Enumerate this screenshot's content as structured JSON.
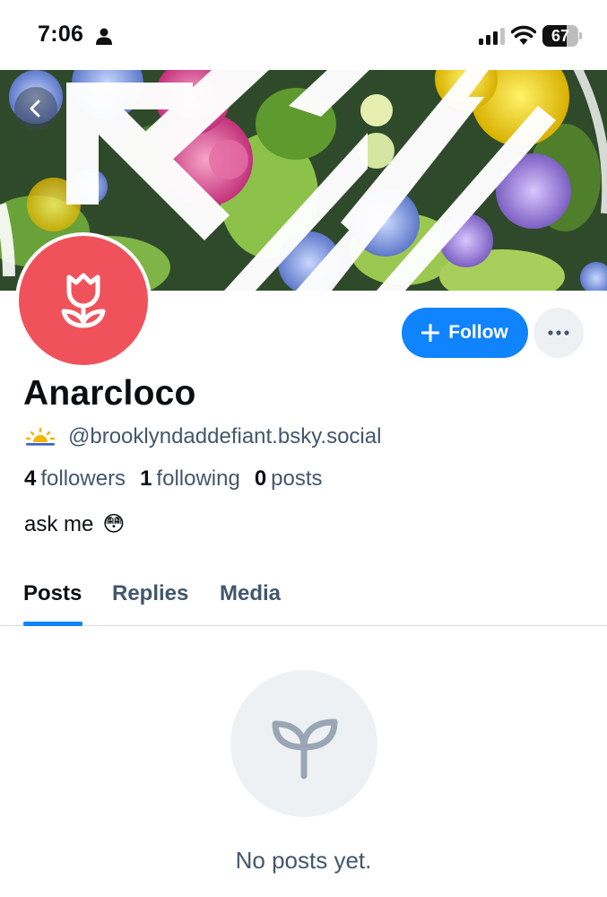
{
  "status_bar": {
    "time": "7:06",
    "battery_percent": "67",
    "icons": [
      "person-icon",
      "signal-icon",
      "wifi-icon",
      "battery-icon"
    ]
  },
  "navigation": {
    "back_icon": "chevron-left-icon"
  },
  "profile": {
    "display_name": "Anarcloco",
    "handle": "@brooklyndaddefiant.bsky.social",
    "handle_icon": "sunrise-icon",
    "avatar_icon": "tulip-icon",
    "avatar_color": "#f0525c",
    "bio_text": "ask me",
    "bio_emoji": "😳",
    "stats": [
      {
        "count": "4",
        "label": "followers"
      },
      {
        "count": "1",
        "label": "following"
      },
      {
        "count": "0",
        "label": "posts"
      }
    ]
  },
  "actions": {
    "follow_label": "Follow",
    "follow_icon": "plus-icon",
    "more_icon": "ellipsis-icon",
    "accent_color": "#1083fe"
  },
  "tabs": [
    {
      "label": "Posts",
      "active": true
    },
    {
      "label": "Replies",
      "active": false
    },
    {
      "label": "Media",
      "active": false
    }
  ],
  "empty_state": {
    "icon": "sprout-icon",
    "message": "No posts yet."
  }
}
